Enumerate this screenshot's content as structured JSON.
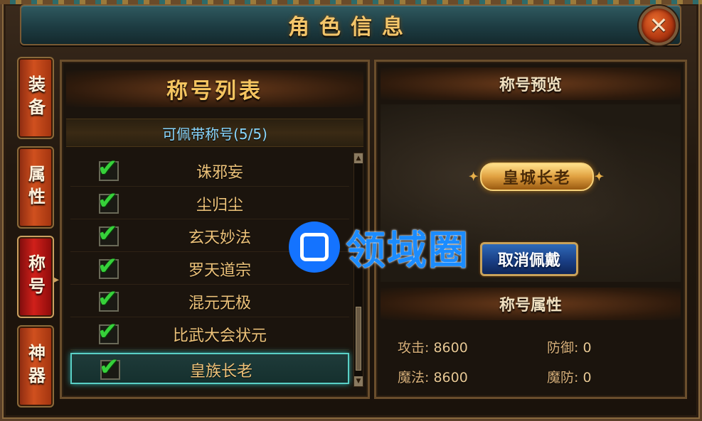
{
  "window": {
    "title": "角色信息",
    "close_label": "✕"
  },
  "tabs": [
    {
      "label": "装备",
      "active": false
    },
    {
      "label": "属性",
      "active": false
    },
    {
      "label": "称号",
      "active": true
    },
    {
      "label": "神器",
      "active": false
    }
  ],
  "left_panel": {
    "title": "称号列表",
    "subtitle": "可佩带称号(5/5)",
    "items": [
      {
        "name": "诛邪妄",
        "checked": true
      },
      {
        "name": "尘归尘",
        "checked": true
      },
      {
        "name": "玄天妙法",
        "checked": true
      },
      {
        "name": "罗天道宗",
        "checked": true
      },
      {
        "name": "混元无极",
        "checked": true
      },
      {
        "name": "比武大会状元",
        "checked": true
      },
      {
        "name": "皇族长老",
        "checked": true,
        "selected": true
      }
    ],
    "check_glyph": "✔",
    "scroll_up": "▲",
    "scroll_down": "▼"
  },
  "right_panel": {
    "preview_title": "称号预览",
    "badge_text": "皇城长老",
    "cancel_button": "取消佩戴",
    "attr_title": "称号属性",
    "attributes": {
      "attack": {
        "label": "攻击:",
        "value": "8600"
      },
      "defense": {
        "label": "防御:",
        "value": "0"
      },
      "magic": {
        "label": "魔法:",
        "value": "8600"
      },
      "magic_defense": {
        "label": "魔防:",
        "value": "0"
      }
    }
  },
  "watermark": {
    "text": "领域圈"
  }
}
